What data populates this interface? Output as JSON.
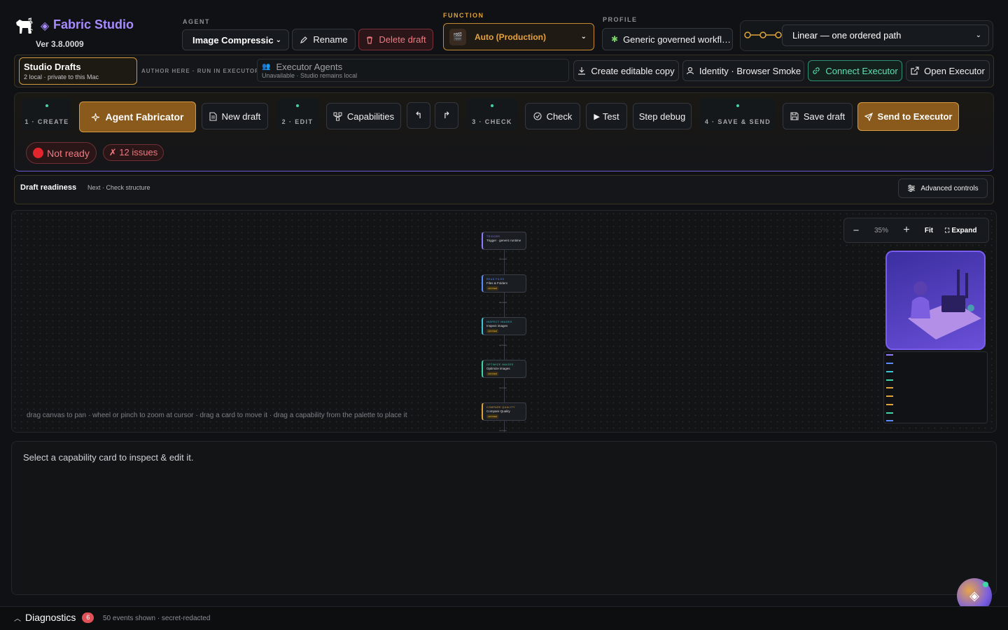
{
  "header": {
    "brand_small": "zynga",
    "app_name": "Fabric Studio",
    "version": "Ver 3.8.0009",
    "agent_label": "AGENT",
    "agent_value": "Image Compressic",
    "rename": "Rename",
    "delete_draft": "Delete draft",
    "function_label": "FUNCTION",
    "function_value": "Auto (Production)",
    "profile_label": "PROFILE",
    "profile_value": "Generic governed workfl…",
    "path_value": "Linear — one ordered path"
  },
  "bar2": {
    "drafts_title": "Studio Drafts",
    "drafts_sub": "2 local · private to this Mac",
    "author_note": "AUTHOR HERE · RUN IN EXECUTOR",
    "executor_title": "Executor Agents",
    "executor_sub": "Unavailable · Studio remains local",
    "create_copy": "Create editable copy",
    "identity": "Identity · Browser Smoke",
    "connect": "Connect Executor",
    "open": "Open Executor"
  },
  "steps": {
    "s1": "1 · CREATE",
    "agent_fabricator": "Agent Fabricator",
    "new_draft": "New draft",
    "s2": "2 · EDIT",
    "capabilities": "Capabilities",
    "s3": "3 · CHECK",
    "check": "Check",
    "test": "Test",
    "step_debug": "Step debug",
    "s4": "4 · SAVE & SEND",
    "save_draft": "Save draft",
    "send": "Send to Executor",
    "not_ready": "Not ready",
    "issues": "✗ 12 issues"
  },
  "readiness": {
    "title": "Draft readiness",
    "next": "Next · Check structure",
    "advanced": "Advanced controls"
  },
  "canvas": {
    "zoom": "35%",
    "fit": "Fit",
    "expand": "Expand",
    "hint": "drag canvas to pan · wheel or pinch to zoom at cursor · drag a card to move it · drag a capability from the palette to place it",
    "nodes": [
      {
        "kind": "TRIGGER",
        "title": "Trigger · generic runtime",
        "tag": ""
      },
      {
        "kind": "READ FILES",
        "title": "Files & Folders",
        "tag": "ADVISED"
      },
      {
        "kind": "INSPECT IMAGES",
        "title": "Inspect images",
        "tag": "ADVISED"
      },
      {
        "kind": "OPTIMIZE IMAGES",
        "title": "Optimize images",
        "tag": "ADVISED"
      },
      {
        "kind": "COMPARE QUALITY",
        "title": "Compare Quality",
        "tag": "ADVISED"
      }
    ],
    "edge_label": "success"
  },
  "inspector": {
    "placeholder": "Select a capability card to inspect & edit it."
  },
  "footer": {
    "diagnostics": "Diagnostics",
    "count": "6",
    "events": "50 events shown · secret-redacted"
  },
  "colors": {
    "accent_purple": "#a88bff",
    "accent_gold": "#e0a43a",
    "danger": "#e0525a",
    "teal": "#3fd6a5"
  }
}
